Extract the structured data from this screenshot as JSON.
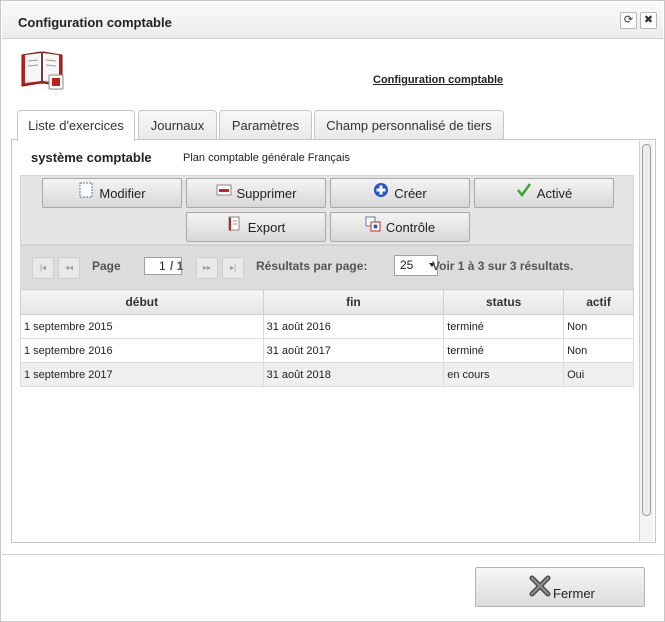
{
  "window": {
    "title": "Configuration comptable",
    "refresh_glyph": "⟳",
    "close_glyph": "✖"
  },
  "header": {
    "link_label": "Configuration comptable"
  },
  "tabs": [
    {
      "label": "Liste d'exercices",
      "active": true
    },
    {
      "label": "Journaux"
    },
    {
      "label": "Paramètres"
    },
    {
      "label": "Champ personnalisé de tiers"
    }
  ],
  "system": {
    "label": "système comptable",
    "value": "Plan comptable générale Français"
  },
  "toolbar": {
    "modifier": {
      "label": "Modifier",
      "icon": "edit-icon"
    },
    "supprimer": {
      "label": "Supprimer",
      "icon": "delete-icon"
    },
    "creer": {
      "label": "Créer",
      "icon": "add-icon"
    },
    "active": {
      "label": "Activé",
      "icon": "check-icon"
    },
    "export": {
      "label": "Export",
      "icon": "export-icon"
    },
    "controle": {
      "label": "Contrôle",
      "icon": "control-icon"
    }
  },
  "pager": {
    "first": "|◂",
    "prev": "◂◂",
    "next": "▸▸",
    "last": "▸|",
    "page_label": "Page",
    "page_value": "1",
    "total_pages": "/ 1",
    "per_page_label": "Résultats par page:",
    "per_page_value": "25",
    "summary": "Voir 1 à 3 sur 3 résultats."
  },
  "table": {
    "columns": [
      "début",
      "fin",
      "status",
      "actif"
    ],
    "rows": [
      [
        "1 septembre 2015",
        "31 août 2016",
        "terminé",
        "Non"
      ],
      [
        "1 septembre 2016",
        "31 août 2017",
        "terminé",
        "Non"
      ],
      [
        "1 septembre 2017",
        "31 août 2018",
        "en cours",
        "Oui"
      ]
    ]
  },
  "footer": {
    "close_label": "Fermer",
    "close_icon": "close-x-icon"
  },
  "colors": {
    "toolbar_bg": "#e4e4e4",
    "pager_bg": "#dcdcdc",
    "delete_red": "#cc2222",
    "create_blue": "#2255cc",
    "check_green": "#3aa53a"
  }
}
